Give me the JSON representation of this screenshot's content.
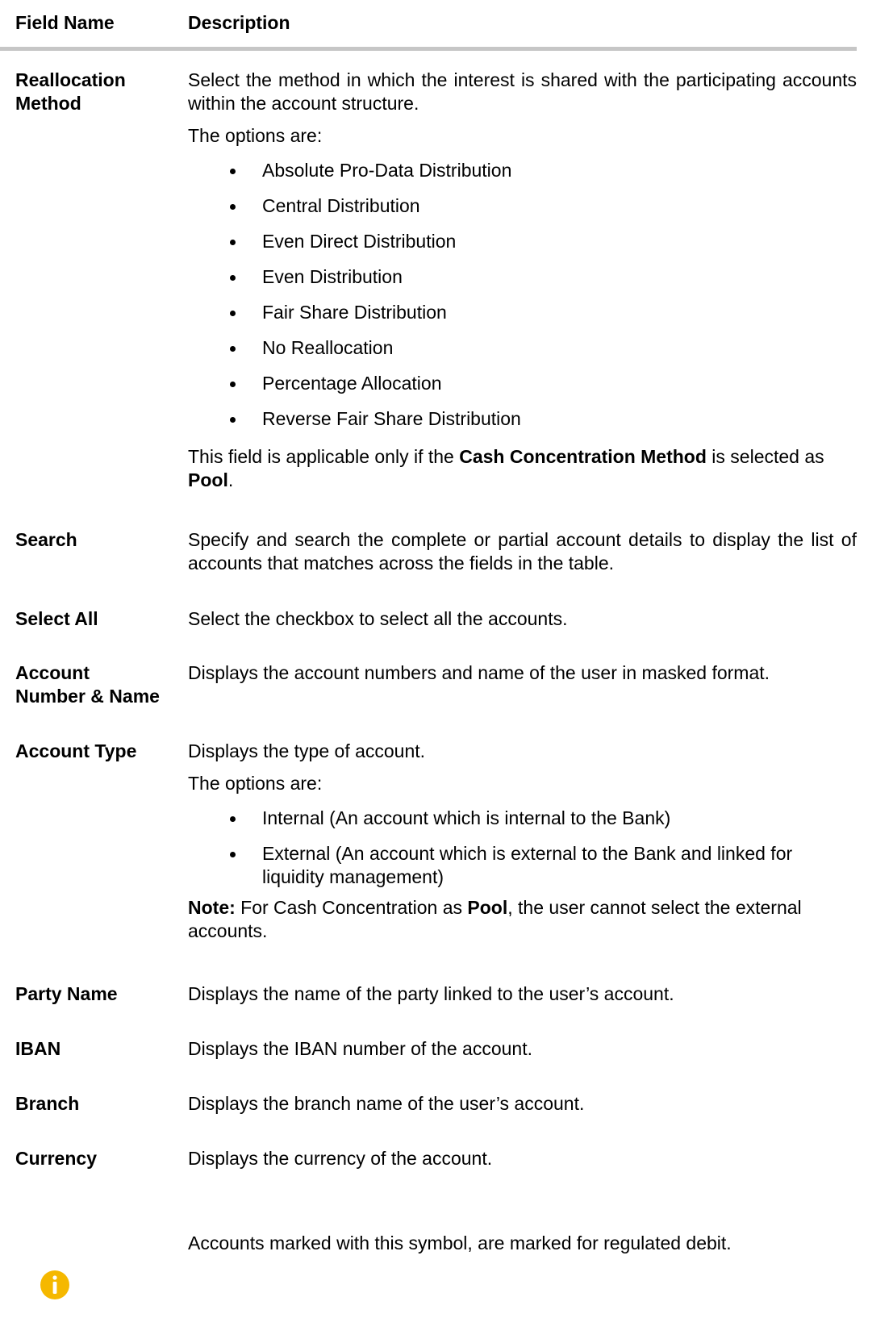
{
  "header": {
    "field_name": "Field Name",
    "description": "Description"
  },
  "rows": {
    "reallocation": {
      "name_line1": "Reallocation",
      "name_line2": "Method",
      "desc": "Select the method in which the interest is shared with the participating accounts within the account structure.",
      "options_intro": "The options are:",
      "options": [
        "Absolute Pro-Data Distribution",
        "Central Distribution",
        "Even Direct Distribution",
        "Even Distribution",
        "Fair Share Distribution",
        "No Reallocation",
        "Percentage Allocation",
        "Reverse Fair Share Distribution"
      ],
      "note_prefix": "This field is applicable only if the ",
      "note_bold1": "Cash Concentration Method",
      "note_mid": " is selected as ",
      "note_bold2": "Pool",
      "note_suffix": "."
    },
    "search": {
      "name": "Search",
      "desc": "Specify and search the complete or partial account details to display the list of accounts that matches across the fields in the table."
    },
    "select_all": {
      "name": "Select All",
      "desc": "Select the checkbox to select all the accounts."
    },
    "account_number": {
      "name_line1": "Account",
      "name_line2": "Number & Name",
      "desc": "Displays the account numbers and name of the user in masked format."
    },
    "account_type": {
      "name": "Account Type",
      "desc": "Displays the type of account.",
      "options_intro": "The options are:",
      "options": [
        "Internal (An account which is internal to the Bank)",
        "External (An account which is external to the Bank and linked for liquidity management)"
      ],
      "note_label": "Note:",
      "note_text1": " For Cash Concentration as ",
      "note_bold": "Pool",
      "note_text2": ", the user cannot select the external accounts."
    },
    "party_name": {
      "name": "Party Name",
      "desc": "Displays the name of the party linked to the user’s account."
    },
    "iban": {
      "name": "IBAN",
      "desc": "Displays the IBAN number of the account."
    },
    "branch": {
      "name": "Branch",
      "desc": "Displays the branch name of the user’s account."
    },
    "currency": {
      "name": "Currency",
      "desc": "Displays the currency of the account."
    }
  },
  "info": {
    "icon": "info-icon",
    "icon_color": "#f5b800",
    "text": "Accounts marked with this symbol, are marked for regulated debit."
  }
}
